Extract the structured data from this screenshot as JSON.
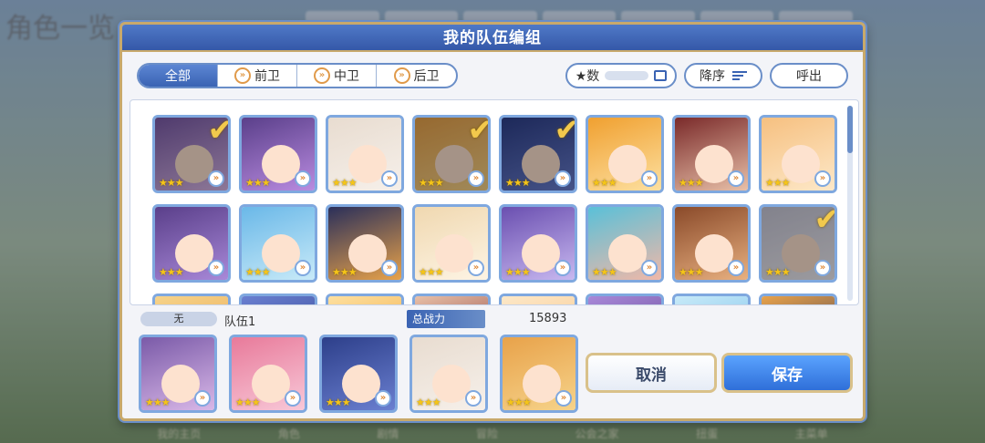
{
  "background": {
    "title": "角色一览",
    "bottom_nav": [
      "我的主页",
      "角色",
      "剧情",
      "冒险",
      "公会之家",
      "扭蛋",
      "主菜单"
    ]
  },
  "dialog": {
    "title": "我的队伍编组",
    "tabs": [
      {
        "label": "全部",
        "active": true,
        "icon": ""
      },
      {
        "label": "前卫",
        "active": false,
        "icon": "chevron-double-icon"
      },
      {
        "label": "中卫",
        "active": false,
        "icon": "chevron-double-icon"
      },
      {
        "label": "后卫",
        "active": false,
        "icon": "chevron-double-icon"
      }
    ],
    "sort_label": "★数",
    "order_label": "降序",
    "call_label": "呼出",
    "roster": [
      {
        "selected": true,
        "stars": "★★★",
        "c1": "#7a5aa8",
        "c2": "#d9b8e8"
      },
      {
        "selected": false,
        "stars": "★★★",
        "c1": "#5a3f8a",
        "c2": "#b98be0"
      },
      {
        "selected": false,
        "stars": "★★★",
        "c1": "#e8dcd0",
        "c2": "#f6f0ea"
      },
      {
        "selected": true,
        "stars": "★★★",
        "c1": "#e8a24a",
        "c2": "#f6d38a"
      },
      {
        "selected": true,
        "stars": "★★★",
        "c1": "#2d3f8a",
        "c2": "#6a7fd0"
      },
      {
        "selected": false,
        "stars": "★★★",
        "c1": "#f0a030",
        "c2": "#fde0a0"
      },
      {
        "selected": false,
        "stars": "★★★",
        "c1": "#7a2a2a",
        "c2": "#e8c0a8"
      },
      {
        "selected": false,
        "stars": "★★★",
        "c1": "#f6c080",
        "c2": "#fde8c8"
      },
      {
        "selected": false,
        "stars": "★★★",
        "c1": "#5a3f8a",
        "c2": "#a888d8"
      },
      {
        "selected": false,
        "stars": "★★★",
        "c1": "#6ab8e8",
        "c2": "#c8eaf8"
      },
      {
        "selected": false,
        "stars": "★★★",
        "c1": "#2a2f5a",
        "c2": "#e8a24a"
      },
      {
        "selected": false,
        "stars": "★★★",
        "c1": "#f0d8b0",
        "c2": "#fdf4e4"
      },
      {
        "selected": false,
        "stars": "★★★",
        "c1": "#6a4fb0",
        "c2": "#c8b8f0"
      },
      {
        "selected": false,
        "stars": "★★★",
        "c1": "#5ac0d8",
        "c2": "#f0b8a8"
      },
      {
        "selected": false,
        "stars": "★★★",
        "c1": "#8a4a2a",
        "c2": "#e8b080"
      },
      {
        "selected": true,
        "stars": "★★★",
        "c1": "#c8c8d8",
        "c2": "#f0eef4"
      }
    ],
    "party": {
      "badge": "无",
      "name": "队伍1",
      "power_label": "总战力",
      "power_value": "15893",
      "members": [
        {
          "stars": "★★★",
          "c1": "#7a5aa8",
          "c2": "#d9b8e8"
        },
        {
          "stars": "★★★",
          "c1": "#e87a9a",
          "c2": "#f8c8d8"
        },
        {
          "stars": "★★★",
          "c1": "#2d3f8a",
          "c2": "#6a7fd0"
        },
        {
          "stars": "★★★",
          "c1": "#e8dcd0",
          "c2": "#f6f0ea"
        },
        {
          "stars": "★★★",
          "c1": "#e8a24a",
          "c2": "#f6d38a"
        }
      ]
    },
    "cancel_label": "取消",
    "save_label": "保存"
  }
}
